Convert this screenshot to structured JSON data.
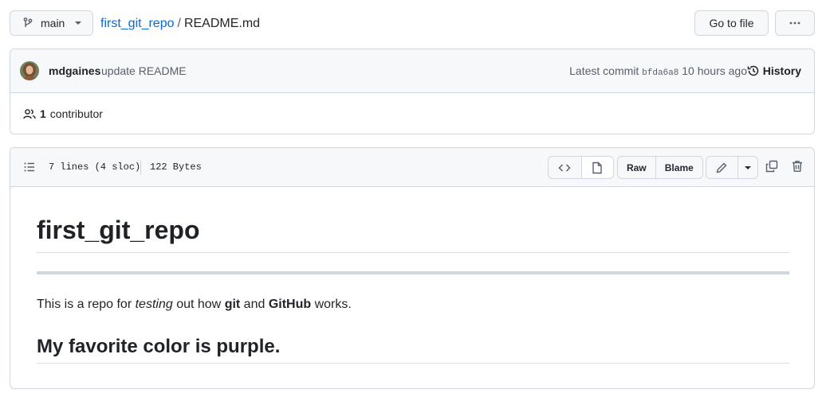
{
  "branch": {
    "name": "main",
    "branch_icon": "git-branch-icon",
    "caret_icon": "triangle-down-icon"
  },
  "breadcrumb": {
    "repo": "first_git_repo",
    "separator": "/",
    "file": "README.md"
  },
  "top_actions": {
    "goto_label": "Go to file",
    "more_label": "···"
  },
  "commit": {
    "author": "mdgaines",
    "message": "update README",
    "latest_prefix": "Latest commit",
    "sha": "bfda6a8",
    "time": "10 hours ago",
    "history_label": "History",
    "history_icon": "history-icon"
  },
  "contributors": {
    "count": "1",
    "label": "contributor",
    "icon": "people-icon"
  },
  "file_header": {
    "lines": "7 lines (4 sloc)",
    "size": "122 Bytes",
    "toc_icon": "list-unordered-icon",
    "code_icon": "code-icon",
    "file_icon": "file-icon",
    "raw_label": "Raw",
    "blame_label": "Blame",
    "edit_icon": "pencil-icon",
    "dropdown_icon": "triangle-down-icon",
    "copy_icon": "copy-icon",
    "delete_icon": "trash-icon"
  },
  "readme": {
    "h1": "first_git_repo",
    "p_prefix": "This is a repo for ",
    "p_em": "testing",
    "p_mid1": " out how ",
    "p_strong1": "git",
    "p_mid2": " and ",
    "p_strong2": "GitHub",
    "p_suffix": " works.",
    "h2": "My favorite color is purple."
  },
  "colors": {
    "link": "#0969da",
    "muted": "#57606a",
    "border": "#d0d7de",
    "header_bg": "#f6f8fa"
  }
}
